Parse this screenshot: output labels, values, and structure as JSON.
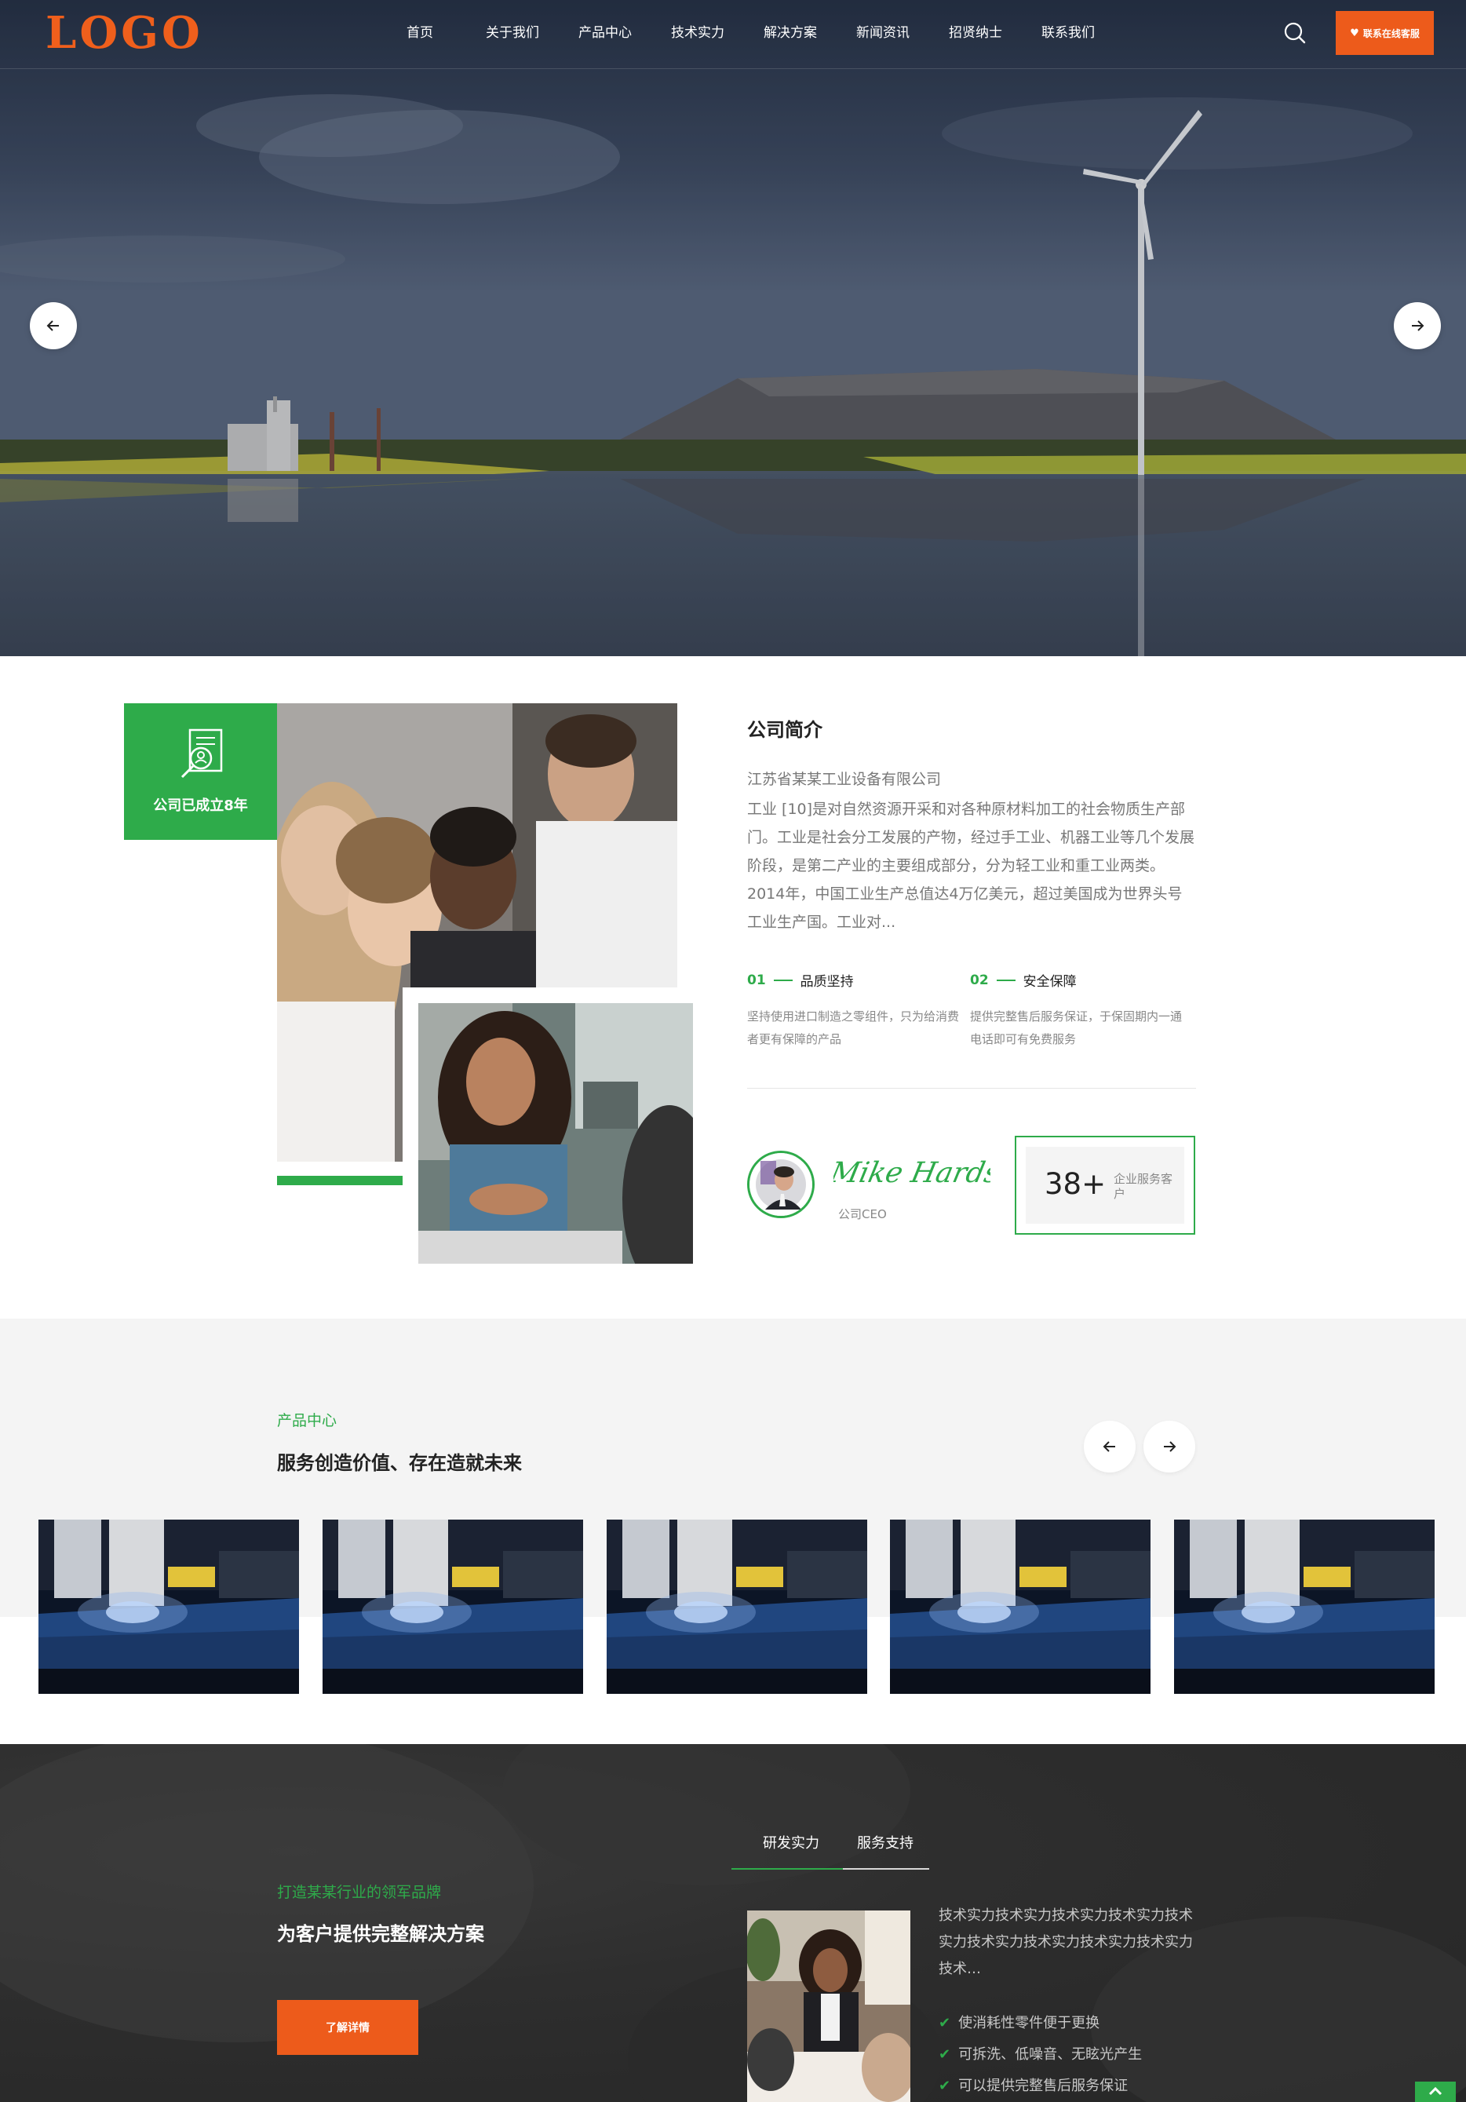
{
  "header": {
    "logo": "LOGO",
    "nav": [
      {
        "label": "首页"
      },
      {
        "label": "关于我们"
      },
      {
        "label": "产品中心"
      },
      {
        "label": "技术实力"
      },
      {
        "label": "解决方案"
      },
      {
        "label": "新闻资讯"
      },
      {
        "label": "招贤纳士"
      },
      {
        "label": "联系我们"
      }
    ],
    "cta_label": "联系在线客服",
    "search_icon": "search-icon",
    "heart_icon": "heart-icon"
  },
  "hero": {
    "prev_icon": "arrow-left-icon",
    "next_icon": "arrow-right-icon"
  },
  "about": {
    "badge_text": "公司已成立8年",
    "title": "公司简介",
    "company": "江苏省某某工业设备有限公司",
    "description": "工业 [10]是对自然资源开采和对各种原材料加工的社会物质生产部门。工业是社会分工发展的产物，经过手工业、机器工业等几个发展阶段，是第二产业的主要组成部分，分为轻工业和重工业两类。2014年，中国工业生产总值达4万亿美元，超过美国成为世界头号工业生产国。工业对...",
    "features": [
      {
        "num": "01",
        "title": "品质坚持",
        "desc": "坚持使用进口制造之零组件，只为给消费者更有保障的产品"
      },
      {
        "num": "02",
        "title": "安全保障",
        "desc": "提供完整售后服务保证，于保固期内一通电话即可有免费服务"
      }
    ],
    "signature": "Mike Hardson",
    "ceo_label": "公司CEO",
    "stat_value": "38+",
    "stat_label": "企业服务客户"
  },
  "products": {
    "subtitle": "产品中心",
    "title": "服务创造价值、存在造就未来",
    "cards": [
      {},
      {},
      {},
      {},
      {}
    ]
  },
  "solutions": {
    "subtitle": "打造某某行业的领军品牌",
    "title": "为客户提供完整解决方案",
    "button": "了解详情",
    "tabs": [
      {
        "label": "研发实力"
      },
      {
        "label": "服务支持"
      }
    ],
    "text": "技术实力技术实力技术实力技术实力技术实力技术实力技术实力技术实力技术实力技术…",
    "list": [
      "使消耗性零件便于更换",
      "可拆洗、低噪音、无眩光产生",
      "可以提供完整售后服务保证"
    ]
  },
  "colors": {
    "brand_green": "#2eab4a",
    "accent_orange": "#ed5b1b",
    "dark_bg": "#2e2e2e",
    "light_bg": "#f4f4f4"
  }
}
